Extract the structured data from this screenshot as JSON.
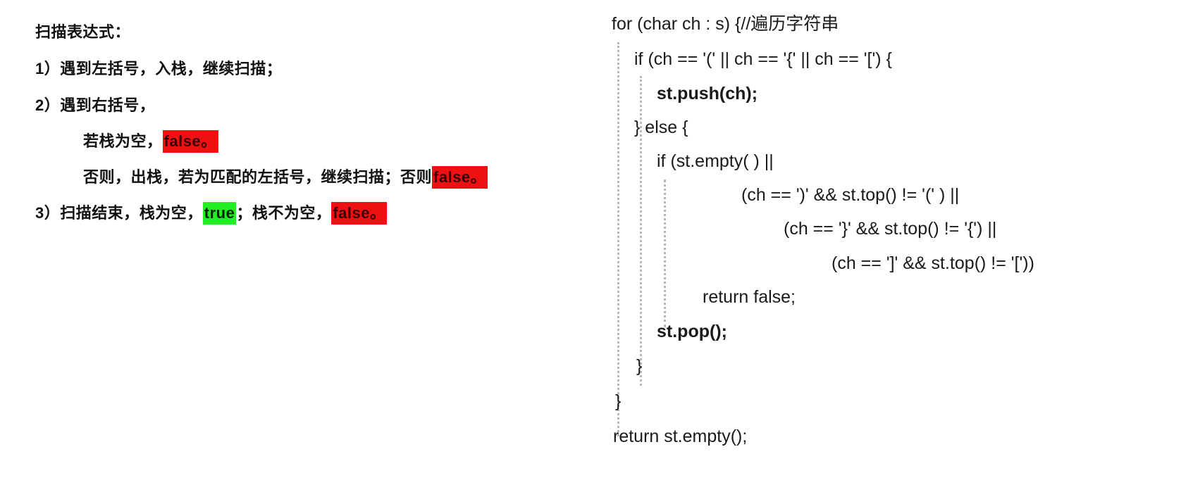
{
  "explanation": {
    "title": "扫描表达式：",
    "rule1": "1）遇到左括号，入栈，继续扫描；",
    "rule2": "2）遇到右括号，",
    "rule2a_text": "若栈为空，",
    "rule2a_result": "false。",
    "rule2b_text": "否则，出栈，若为匹配的左括号，继续扫描；否则",
    "rule2b_result": "false。",
    "rule3_text1": "3）扫描结束，栈为空，",
    "rule3_true": "true",
    "rule3_text2": "；栈不为空，",
    "rule3_false": "false。",
    "colors": {
      "false_highlight": "#ee1111",
      "true_highlight": "#22ee22"
    }
  },
  "code": {
    "line1": "for (char ch : s) {//遍历字符串",
    "line2": "if (ch == '(' || ch == '{' || ch == '[') {",
    "line3": "st.push(ch);",
    "line4": "} else {",
    "line5": "if (st.empty( ) ||",
    "line6": "(ch == ')' && st.top() != '(' ) ||",
    "line7": "(ch == '}' && st.top() != '{') ||",
    "line8": "(ch == ']' && st.top() != '['))",
    "line9": "return false;",
    "line10": "st.pop();",
    "line11": "}",
    "line12": "}",
    "line13": "return st.empty();"
  }
}
